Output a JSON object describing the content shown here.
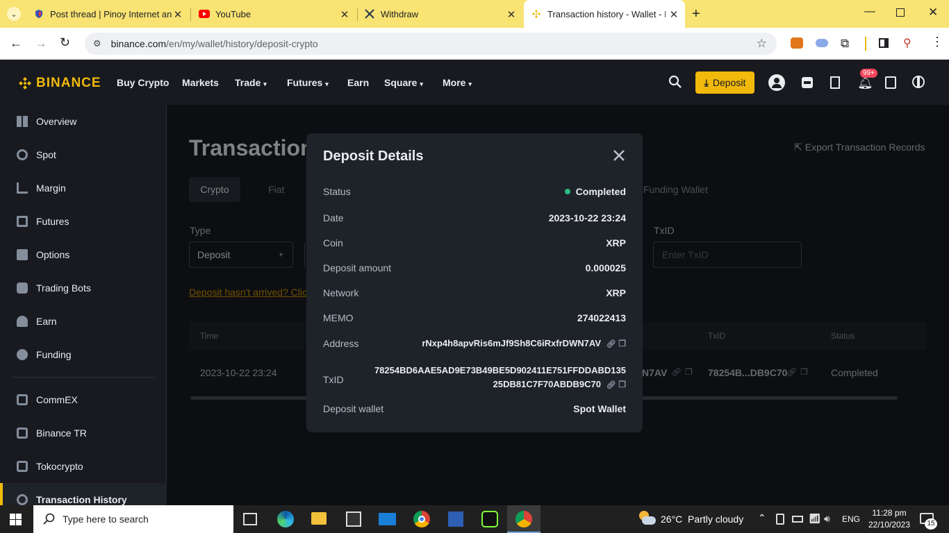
{
  "browser": {
    "tabs": [
      {
        "title": "Post thread | Pinoy Internet an",
        "icon": "shield-icon"
      },
      {
        "title": "YouTube",
        "icon": "youtube-icon"
      },
      {
        "title": "Withdraw",
        "icon": "crossed-swords-icon"
      },
      {
        "title": "Transaction history - Wallet - B",
        "icon": "binance-icon"
      }
    ],
    "url_domain": "binance.com",
    "url_path": "/en/my/wallet/history/deposit-crypto"
  },
  "header": {
    "logo": "BINANCE",
    "nav": [
      "Buy Crypto",
      "Markets",
      "Trade",
      "Futures",
      "Earn",
      "Square",
      "More"
    ],
    "deposit_label": "Deposit",
    "notif_badge": "99+"
  },
  "sidebar": {
    "items": [
      {
        "label": "Overview"
      },
      {
        "label": "Spot"
      },
      {
        "label": "Margin"
      },
      {
        "label": "Futures"
      },
      {
        "label": "Options"
      },
      {
        "label": "Trading Bots"
      },
      {
        "label": "Earn"
      },
      {
        "label": "Funding"
      },
      {
        "label": "CommEX"
      },
      {
        "label": "Binance TR"
      },
      {
        "label": "Tokocrypto"
      },
      {
        "label": "Transaction History"
      }
    ]
  },
  "page": {
    "title": "Transaction",
    "export_label": "Export Transaction Records",
    "tabs": [
      "Crypto",
      "Fiat"
    ],
    "funding_wallet": "Funding Wallet",
    "type_label": "Type",
    "type_value": "Deposit",
    "txid_label": "TxID",
    "txid_placeholder": "Enter TxID",
    "not_arrived": "Deposit hasn't arrived? Clic",
    "table": {
      "headers": {
        "time": "Time",
        "txid": "TxID",
        "status": "Status"
      },
      "row": {
        "time": "2023-10-22 23:24",
        "address_tail": "N7AV",
        "txid": "78254B...DB9C70",
        "status": "Completed"
      }
    }
  },
  "modal": {
    "title": "Deposit Details",
    "status_label": "Status",
    "status_value": "Completed",
    "date_label": "Date",
    "date_value": "2023-10-22 23:24",
    "coin_label": "Coin",
    "coin_value": "XRP",
    "amount_label": "Deposit amount",
    "amount_value": "0.000025",
    "network_label": "Network",
    "network_value": "XRP",
    "memo_label": "MEMO",
    "memo_value": "274022413",
    "address_label": "Address",
    "address_value": "rNxp4h8apvRis6mJf9Sh8C6iRxfrDWN7AV",
    "txid_label": "TxID",
    "txid_line1": "78254BD6AAE5AD9E73B49BE5D902411E751FFDDABD135",
    "txid_line2": "25DB81C7F70ABDB9C70",
    "wallet_label": "Deposit wallet",
    "wallet_value": "Spot Wallet"
  },
  "taskbar": {
    "search_placeholder": "Type here to search",
    "weather": "26°C  Partly cloudy",
    "lang": "ENG",
    "time": "11:28 pm",
    "date": "22/10/2023",
    "notif_count": "15"
  },
  "colors": {
    "accent": "#f0b90b",
    "bg": "#181a20",
    "modal": "#1e2329",
    "success": "#2ebd85"
  }
}
